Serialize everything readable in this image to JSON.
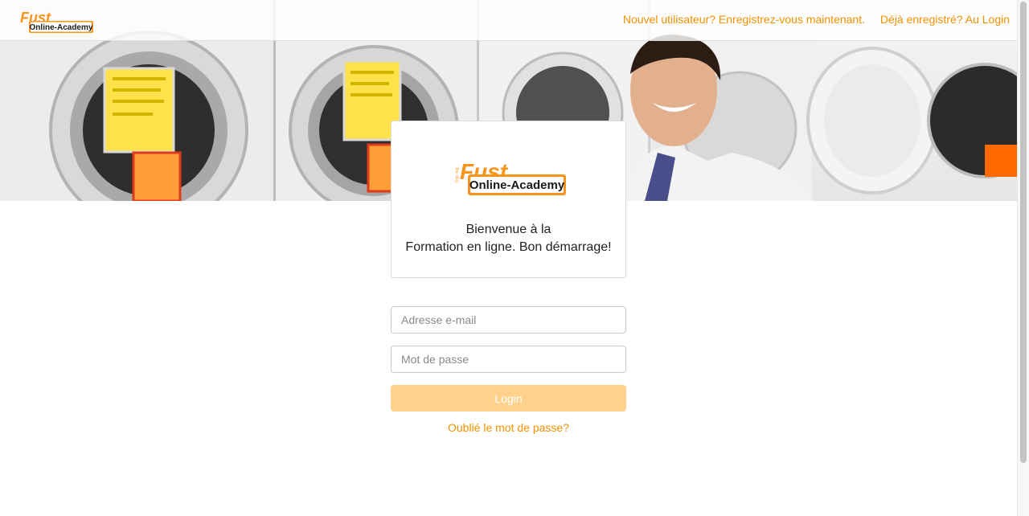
{
  "brand": {
    "logo_word": "Fust",
    "logo_tag": "Online-Academy",
    "logo_small": "Dipl. Ing."
  },
  "nav": {
    "register_link": "Nouvel utilisateur? Enregistrez-vous maintenant.",
    "login_link": "Déjà enregistré? Au Login"
  },
  "welcome": {
    "line1": "Bienvenue à la",
    "line2": "Formation en ligne. Bon démarrage!"
  },
  "form": {
    "email_placeholder": "Adresse e-mail",
    "email_value": "",
    "password_placeholder": "Mot de passe",
    "password_value": "",
    "login_label": "Login",
    "forgot_label": "Oublié le mot de passe?"
  },
  "colors": {
    "accent": "#f29100",
    "button_disabled": "#ffd18a",
    "logo_orange": "#f7941d"
  }
}
